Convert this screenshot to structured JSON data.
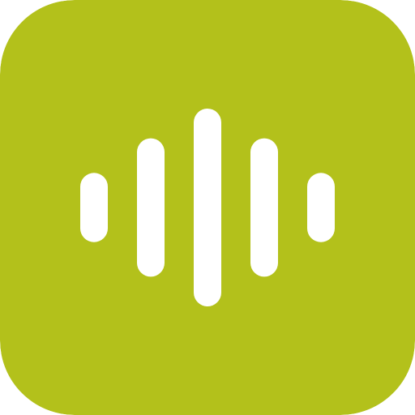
{
  "icon": {
    "name": "audio-waveform-app-icon",
    "background_color": "#b3c11b",
    "glyph_color": "#ffffff",
    "glyph": "sound-wave-icon",
    "bar_levels": [
      0.35,
      0.7,
      1.0,
      0.7,
      0.35
    ]
  }
}
